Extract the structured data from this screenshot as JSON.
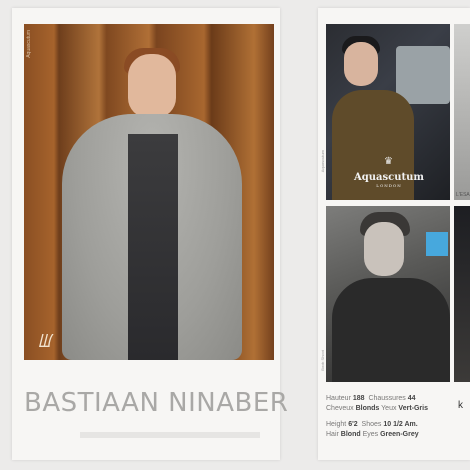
{
  "left_card": {
    "model_name": "BASTIAAN NINABER",
    "photo_credit": "Aquascutum",
    "signature": "ꡆ"
  },
  "right_card": {
    "top_photo": {
      "brand": "Aquascutum",
      "brand_sub": "LONDON",
      "side_credit": "Aquascutum"
    },
    "bottom_photo": {
      "side_credit": "Book Shoot"
    },
    "top_strip_label": "L'ESA"
  },
  "stats": {
    "fr": {
      "height_label": "Hauteur",
      "height_value": "188",
      "shoes_label": "Chaussures",
      "shoes_value": "44",
      "hair_label": "Cheveux",
      "hair_value": "Blonds",
      "eyes_label": "Yeux",
      "eyes_value": "Vert-Gris"
    },
    "en": {
      "height_label": "Height",
      "height_value": "6'2",
      "shoes_label": "Shoes",
      "shoes_value": "10 1/2 Am.",
      "hair_label": "Hair",
      "hair_value": "Blond",
      "eyes_label": "Eyes",
      "eyes_value": "Green-Grey"
    }
  },
  "colors": {
    "name_text": "#a9a8a6",
    "stats_label": "#7a7978",
    "stats_value": "#444444",
    "badge": "#47a8dd"
  }
}
